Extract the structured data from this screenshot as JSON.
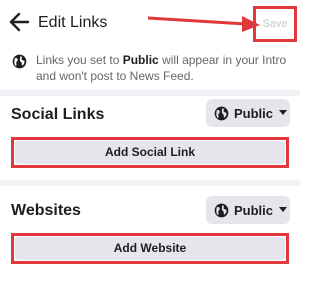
{
  "header": {
    "back_icon": "arrow-left-icon",
    "title": "Edit Links",
    "save_label": "Save"
  },
  "info": {
    "icon": "globe-icon",
    "text_before": "Links you set to ",
    "text_bold": "Public",
    "text_after": " will appear in your Intro and won't post to News Feed."
  },
  "social": {
    "title": "Social Links",
    "privacy_label": "Public",
    "add_label": "Add Social Link"
  },
  "websites": {
    "title": "Websites",
    "privacy_label": "Public",
    "add_label": "Add Website"
  },
  "colors": {
    "annotation_red": "#e0383b",
    "button_gray": "#e4e6eb",
    "muted_text": "#65676b",
    "disabled_text": "#c6c8cc"
  }
}
